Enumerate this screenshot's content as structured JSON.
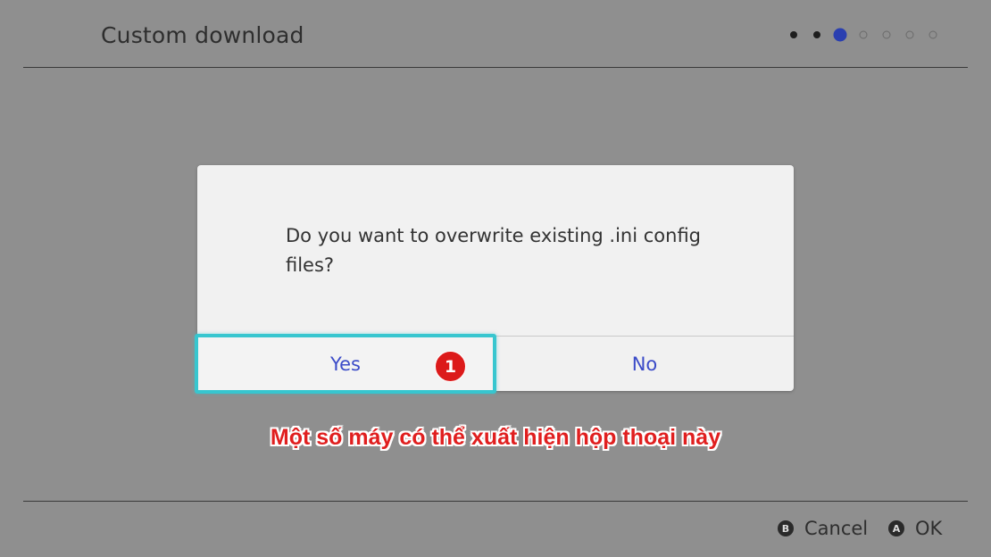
{
  "header": {
    "title": "Custom download",
    "progress": {
      "total_steps": 7,
      "current_step": 3,
      "accent_color": "#2a3fb0"
    }
  },
  "dialog": {
    "message": "Do you want to overwrite existing .ini config files?",
    "yes_label": "Yes",
    "no_label": "No",
    "focus_color": "#37c6cf"
  },
  "annotation": {
    "step_badge": "1",
    "caption": "Một số máy có thể xuất hiện hộp thoại này",
    "color": "#e01f1f"
  },
  "footer": {
    "cancel": {
      "glyph": "B",
      "label": "Cancel",
      "icon": "b-button-icon"
    },
    "ok": {
      "glyph": "A",
      "label": "OK",
      "icon": "a-button-icon"
    }
  }
}
